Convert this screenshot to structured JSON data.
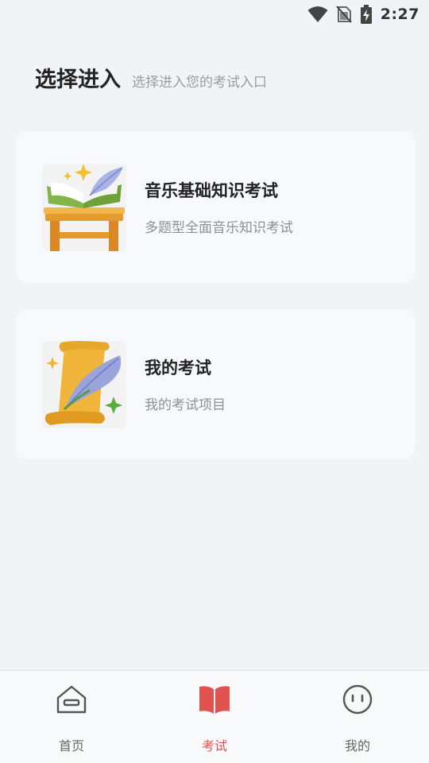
{
  "status_bar": {
    "time": "2:27",
    "icons": [
      "wifi-icon",
      "no-sim-icon",
      "battery-charging-icon"
    ]
  },
  "header": {
    "title": "选择进入",
    "subtitle": "选择进入您的考试入口"
  },
  "cards": [
    {
      "title": "音乐基础知识考试",
      "description": "多题型全面音乐知识考试",
      "image": "open-book-with-quill-illustration"
    },
    {
      "title": "我的考试",
      "description": "我的考试项目",
      "image": "scroll-with-quill-illustration"
    }
  ],
  "tabbar": {
    "active_color": "#e2534f",
    "items": [
      {
        "label": "首页",
        "icon": "home-icon",
        "active": false
      },
      {
        "label": "考试",
        "icon": "book-icon",
        "active": true
      },
      {
        "label": "我的",
        "icon": "face-icon",
        "active": false
      }
    ]
  }
}
